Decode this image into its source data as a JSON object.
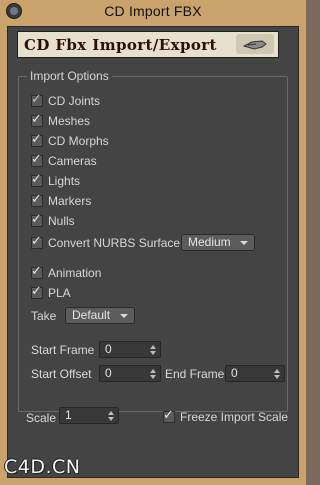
{
  "window": {
    "title": "CD Import FBX"
  },
  "banner": {
    "text": "CD Fbx Import/Export",
    "emblem_icon": "hand-cursor-icon"
  },
  "import_options": {
    "group_label": "Import Options",
    "checkboxes": [
      {
        "label": "CD Joints",
        "checked": true,
        "disabled": true
      },
      {
        "label": "Meshes",
        "checked": true
      },
      {
        "label": "CD Morphs",
        "checked": true
      },
      {
        "label": "Cameras",
        "checked": true
      },
      {
        "label": "Lights",
        "checked": true
      },
      {
        "label": "Markers",
        "checked": true
      },
      {
        "label": "Nulls",
        "checked": true
      },
      {
        "label": "Convert NURBS Surface",
        "checked": true
      }
    ],
    "nurbs_quality": "Medium",
    "animation": {
      "label": "Animation",
      "checked": true
    },
    "pla": {
      "label": "PLA",
      "checked": true
    },
    "take": {
      "label": "Take",
      "value": "Default"
    },
    "start_frame": {
      "label": "Start Frame",
      "value": "0"
    },
    "start_offset": {
      "label": "Start Offset",
      "value": "0"
    },
    "end_frame": {
      "label": "End Frame",
      "value": "0"
    }
  },
  "bottom": {
    "scale": {
      "label": "Scale",
      "value": "1"
    },
    "freeze_import_scale": {
      "label": "Freeze Import Scale",
      "checked": true
    }
  },
  "watermark": "C4D.CN"
}
